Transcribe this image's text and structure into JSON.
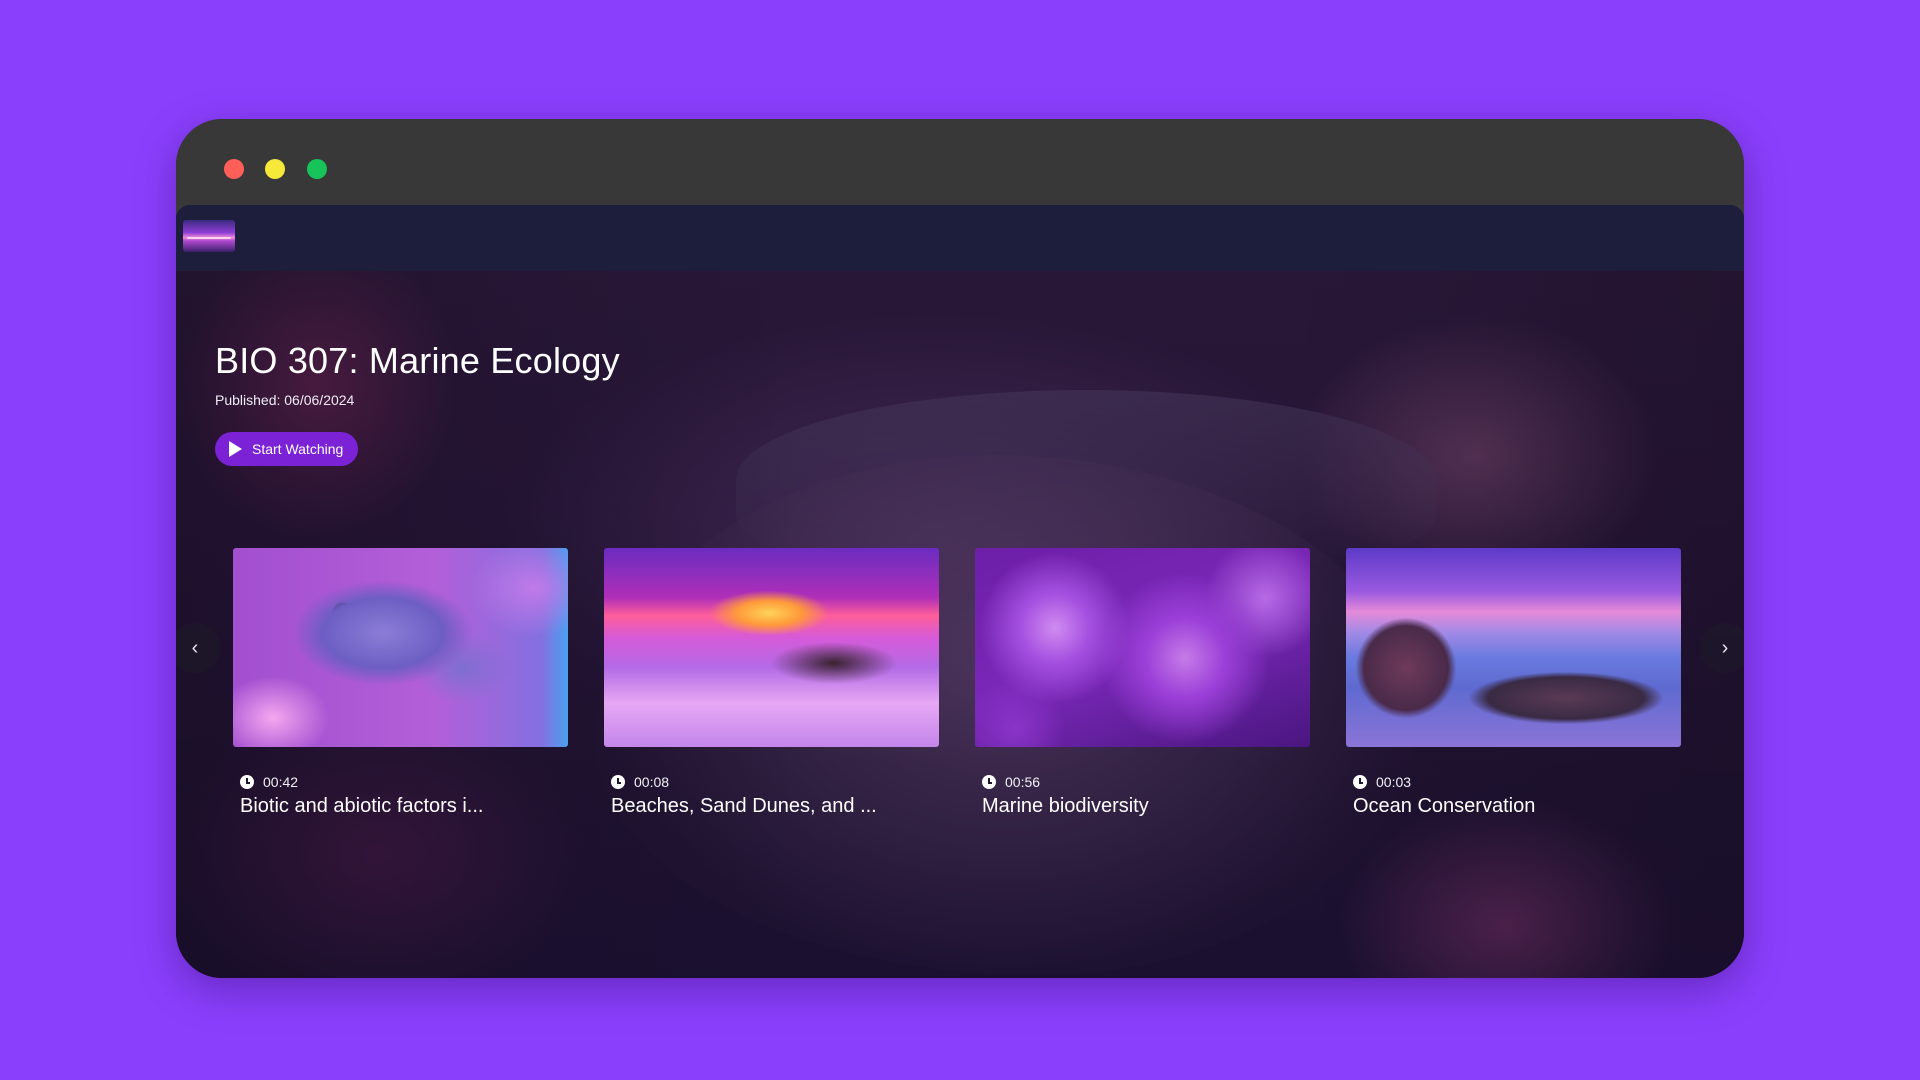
{
  "window": {
    "controls": [
      "close",
      "minimize",
      "maximize"
    ]
  },
  "topbar": {
    "logo_icon": "sunset-logo-icon"
  },
  "hero": {
    "title": "BIO 307: Marine Ecology",
    "published": "Published: 06/06/2024",
    "start_label": "Start Watching",
    "start_icon": "play-icon"
  },
  "carousel": {
    "prev_icon": "chevron-left-icon",
    "next_icon": "chevron-right-icon",
    "prev_glyph": "‹",
    "next_glyph": "›",
    "videos": [
      {
        "duration": "00:42",
        "title": "Biotic and abiotic factors i...",
        "thumbnail": "purple-fish-thumbnail"
      },
      {
        "duration": "00:08",
        "title": "Beaches, Sand Dunes, and ...",
        "thumbnail": "sunset-beach-thumbnail"
      },
      {
        "duration": "00:56",
        "title": "Marine biodiversity",
        "thumbnail": "anemone-clownfish-thumbnail"
      },
      {
        "duration": "00:03",
        "title": "Ocean Conservation",
        "thumbnail": "rocky-coast-thumbnail"
      }
    ]
  },
  "colors": {
    "page_background": "#8a3ffc",
    "window_frame": "#3a3a3a",
    "topbar": "#1c1e3c",
    "accent_button": "#7b22d6",
    "close": "#ff5f57",
    "minimize": "#f6e93a",
    "maximize": "#16c45a"
  }
}
